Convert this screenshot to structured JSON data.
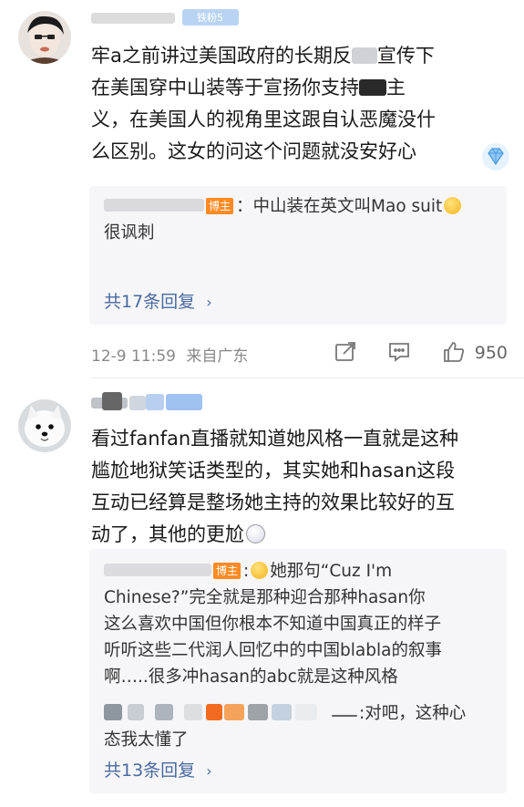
{
  "comments": [
    {
      "username": "",
      "badge": "铁粉5",
      "text": "牢a之前讲过美国政府的长期反 宣传下在美国穿中山装等于宣扬你支持 主义，在美国人的视角里这跟自认恶魔没什么区别。这女的问这个问题就没安好心",
      "lines": [
        "牢a之前讲过美国政府的长期反",
        "宣传下",
        "在美国穿中山装等于宣扬你支持",
        "主",
        "义，在美国人的视角里这跟自认恶魔没什",
        "么区别。这女的问这个问题就没安好心"
      ],
      "replies": [
        {
          "author_tag": "博主",
          "line1": "：中山装在英文叫Mao suit",
          "line2": "很讽刺"
        }
      ],
      "more_replies": "共17条回复",
      "time": "12-9 11:59",
      "location": "来自广东",
      "likes": "950"
    },
    {
      "username": "",
      "lines": [
        "看过fanfan直播就知道她风格一直就是这种",
        "尴尬地狱笑话类型的，其实她和hasan这段",
        "互动已经算是整场她主持的效果比较好的互",
        "动了，其他的更尬"
      ],
      "replies": [
        {
          "author_tag": "博主",
          "lines": [
            "她那句“Cuz I'm",
            "Chinese?”完全就是那种迎合那种hasan你",
            "这么喜欢中国但你根本不知道中国真正的样子",
            "听听这些二代润人回忆中的中国blabla的叙事",
            "啊…..很多冲hasan的abc就是这种风格"
          ]
        },
        {
          "line1": ":对吧，这种心",
          "line2": "态我太懂了"
        }
      ],
      "more_replies": "共13条回复"
    }
  ],
  "colors": {
    "accent_link": "#4a6aa0",
    "host_tag": "#ff8a22",
    "meta_text": "#888888",
    "reply_bg": "#f6f6f8"
  },
  "icons": [
    "share-icon",
    "comment-icon",
    "like-icon",
    "chevron-right-icon",
    "diamond-badge-icon"
  ]
}
